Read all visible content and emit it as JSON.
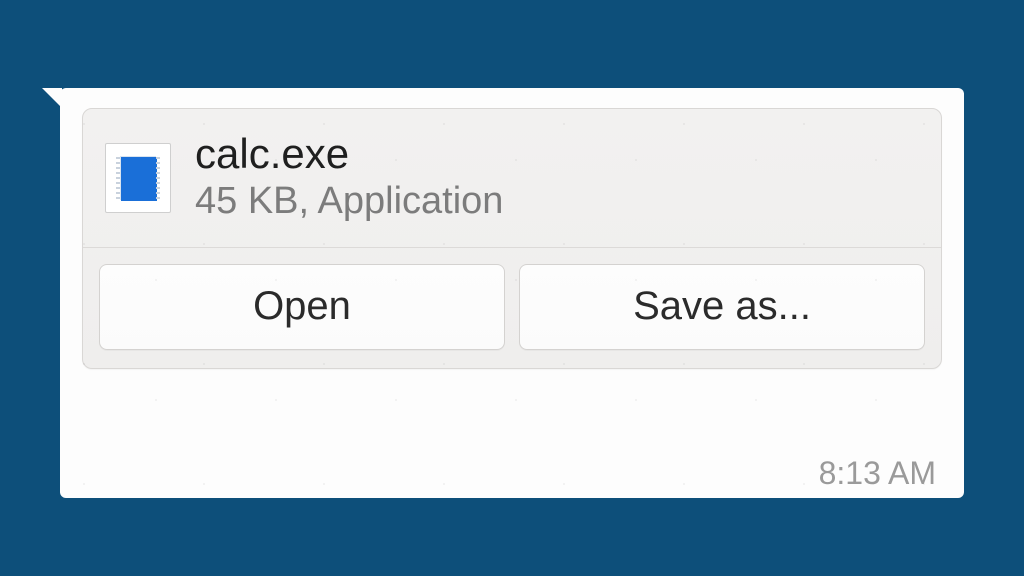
{
  "file": {
    "name": "calc.exe",
    "meta": "45 KB, Application"
  },
  "actions": {
    "open_label": "Open",
    "save_as_label": "Save as..."
  },
  "message": {
    "timestamp": "8:13 AM"
  }
}
